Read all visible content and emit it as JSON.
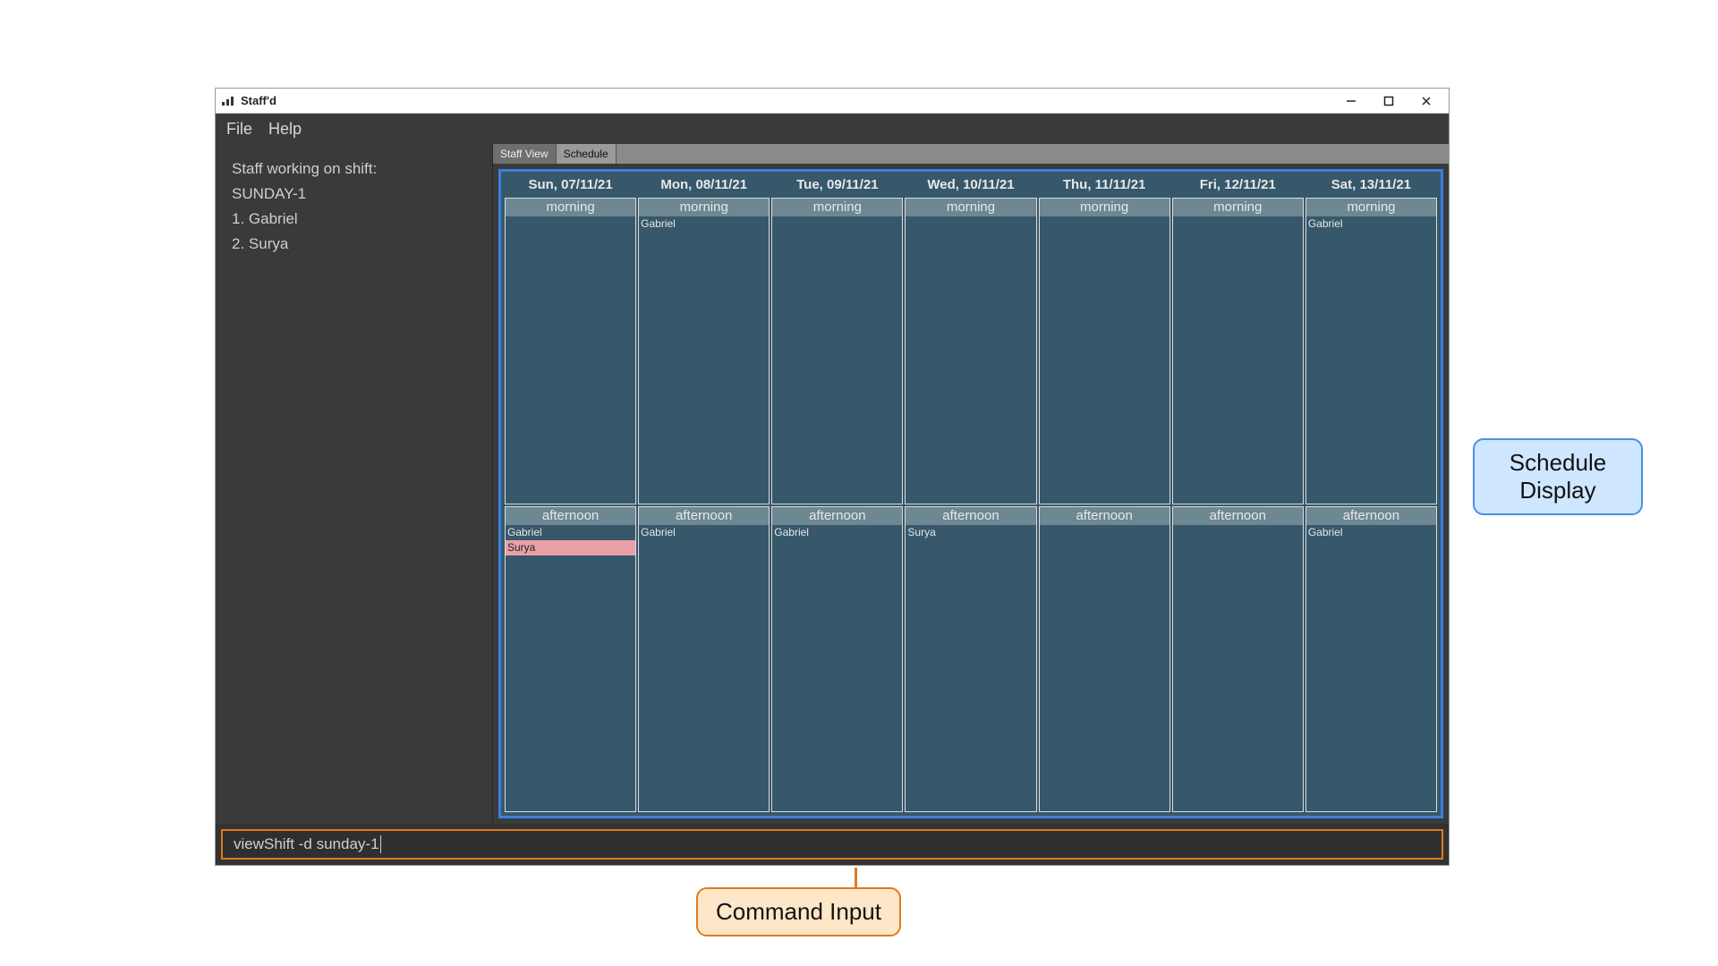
{
  "window": {
    "title": "Staff'd",
    "min_tip": "Minimize",
    "max_tip": "Maximize",
    "close_tip": "Close"
  },
  "menu": {
    "file": "File",
    "help": "Help"
  },
  "sidebar": {
    "heading": "Staff working on shift:",
    "shift_id": "SUNDAY-1",
    "items": [
      "1. Gabriel",
      "2. Surya"
    ]
  },
  "tabs": {
    "staff_view": "Staff View",
    "schedule": "Schedule",
    "active": "schedule"
  },
  "schedule": {
    "slot_labels": {
      "morning": "morning",
      "afternoon": "afternoon"
    },
    "days": [
      {
        "label": "Sun, 07/11/21",
        "morning": [],
        "afternoon": [
          {
            "name": "Gabriel"
          },
          {
            "name": "Surya",
            "hl": true
          }
        ]
      },
      {
        "label": "Mon, 08/11/21",
        "morning": [
          {
            "name": "Gabriel"
          }
        ],
        "afternoon": [
          {
            "name": "Gabriel"
          }
        ]
      },
      {
        "label": "Tue, 09/11/21",
        "morning": [],
        "afternoon": [
          {
            "name": "Gabriel"
          }
        ]
      },
      {
        "label": "Wed, 10/11/21",
        "morning": [],
        "afternoon": [
          {
            "name": "Surya"
          }
        ]
      },
      {
        "label": "Thu, 11/11/21",
        "morning": [],
        "afternoon": []
      },
      {
        "label": "Fri, 12/11/21",
        "morning": [],
        "afternoon": []
      },
      {
        "label": "Sat, 13/11/21",
        "morning": [
          {
            "name": "Gabriel"
          }
        ],
        "afternoon": [
          {
            "name": "Gabriel"
          }
        ]
      }
    ]
  },
  "command": {
    "value": "viewShift -d sunday-1"
  },
  "callouts": {
    "schedule_display": "Schedule\nDisplay",
    "command_input": "Command Input"
  }
}
